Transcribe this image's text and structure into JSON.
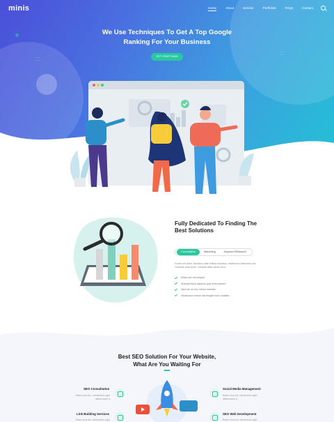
{
  "brand": {
    "logo": "minis"
  },
  "nav": {
    "items": [
      {
        "label": "Home",
        "active": true
      },
      {
        "label": "About"
      },
      {
        "label": "Service"
      },
      {
        "label": "Portfolios"
      },
      {
        "label": "FAQs"
      },
      {
        "label": "Contact"
      }
    ]
  },
  "hero": {
    "title_line1": "We Use Techniques To Get A Top Google",
    "title_line2": "Ranking For Your Business",
    "cta_label": "GET START NOW"
  },
  "solutions": {
    "title_line1": "Fully Dedicated To Finding The",
    "title_line2": "Best Solutions",
    "tabs": [
      "Consultation",
      "Marketing",
      "Keyword Research"
    ],
    "active_tab": "Consultation",
    "description": "Donec dui dolor, faucibus vitae finibus faucibus, vestibulum bibendum dui. Vivamus urna tortor, volutpat vitae varius arcu.",
    "checklist": [
      "Etiam nec nisi aliquet",
      "Suscipit lobus dapibus quis erat posuere",
      "Nam vel mi nec metus molestie",
      "Vestibulum rutrum nisi feugiat nunc sodales"
    ]
  },
  "services": {
    "title_line1": "Best SEO Solution For Your Website,",
    "title_line2": "What Are You Waiting For",
    "items": [
      {
        "title": "SEO Consultation",
        "desc": "Etiam uma dui, elementum eget ullamcorper a"
      },
      {
        "title": "Social Media Management",
        "desc": "Etiam uma dui, elementum eget ullamcorper a"
      },
      {
        "title": "Link Building Services",
        "desc": "Etiam uma dui, elementum eget"
      },
      {
        "title": "SEO Web Development",
        "desc": "Etiam uma dui, elementum eget"
      }
    ]
  },
  "colors": {
    "accent": "#28c9a0",
    "hero_start": "#4a4fd8",
    "hero_end": "#21c4d4"
  }
}
